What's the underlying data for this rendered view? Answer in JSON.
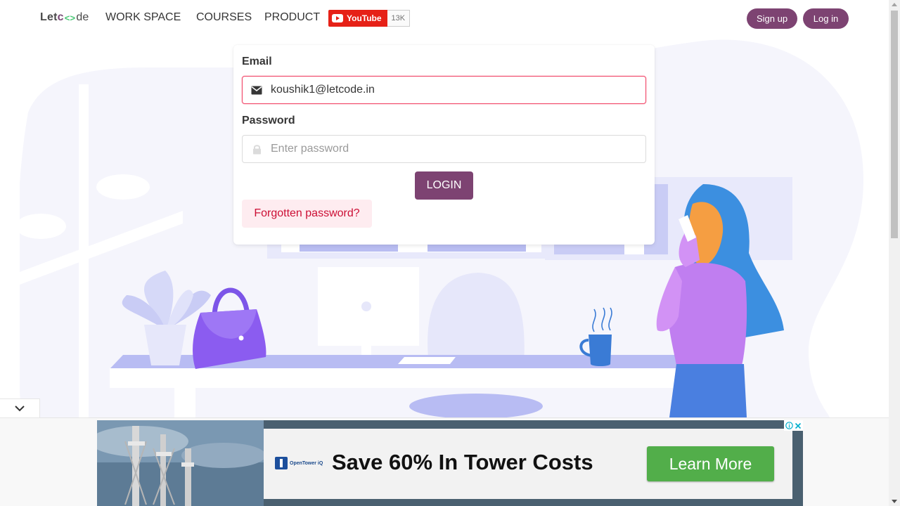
{
  "navbar": {
    "logo": {
      "part1": "Let",
      "part2": "c",
      "part3": "de"
    },
    "links": [
      "WORK SPACE",
      "COURSES",
      "PRODUCT"
    ],
    "youtube": {
      "label": "YouTube",
      "count": "13K"
    },
    "signup_label": "Sign up",
    "login_label": "Log in"
  },
  "form": {
    "email_label": "Email",
    "email_value": "koushik1@letcode.in",
    "password_label": "Password",
    "password_placeholder": "Enter password",
    "login_button": "LOGIN",
    "forgot_button": "Forgotten password?"
  },
  "ad": {
    "brand": "OpenTower iQ",
    "headline": "Save 60% In Tower Costs",
    "cta": "Learn More"
  },
  "colors": {
    "primary": "#7d4372",
    "danger": "#f14668",
    "ad_green": "#52ae4a"
  }
}
